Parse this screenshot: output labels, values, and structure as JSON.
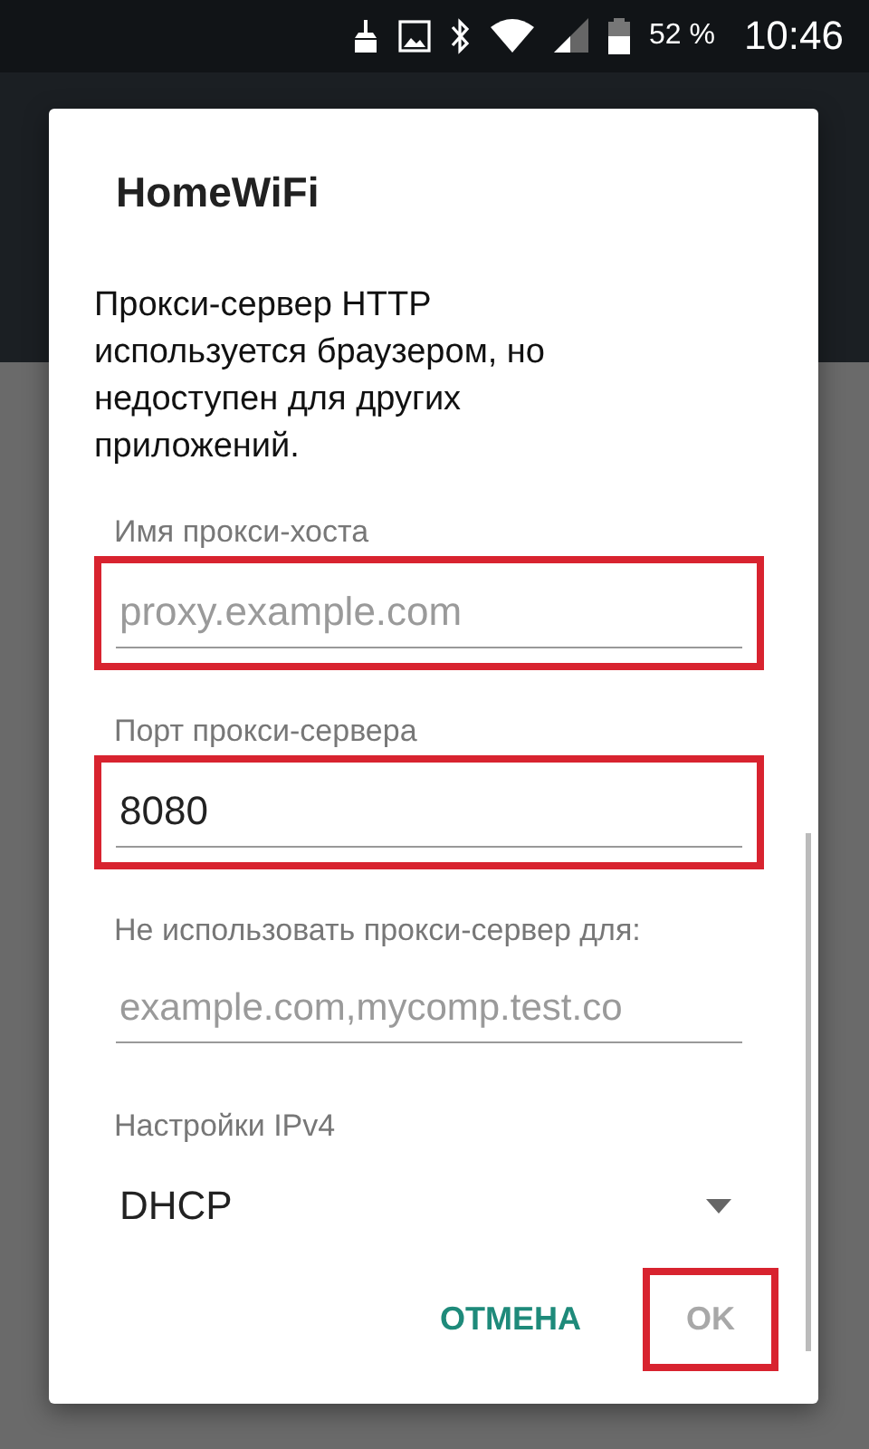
{
  "status_bar": {
    "battery_text": "52 %",
    "time": "10:46"
  },
  "dialog": {
    "title": "HomeWiFi",
    "message": "Прокси-сервер HTTP используется браузером, но недоступен для других приложений.",
    "fields": [
      {
        "kind": "text",
        "label": "Имя прокси-хоста",
        "placeholder": "proxy.example.com",
        "highlighted": true
      },
      {
        "kind": "text",
        "label": "Порт прокси-сервера",
        "value": "8080",
        "highlighted": true
      },
      {
        "kind": "text",
        "label": "Не использовать прокси-сервер для:",
        "placeholder": "example.com,mycomp.test.co",
        "highlighted": false
      },
      {
        "kind": "dropdown",
        "label": "Настройки IPv4",
        "value": "DHCP",
        "highlighted": false
      }
    ],
    "buttons": [
      {
        "label": "ОТМЕНА",
        "disabled": false,
        "highlighted": false
      },
      {
        "label": "OK",
        "disabled": true,
        "highlighted": true
      }
    ]
  }
}
